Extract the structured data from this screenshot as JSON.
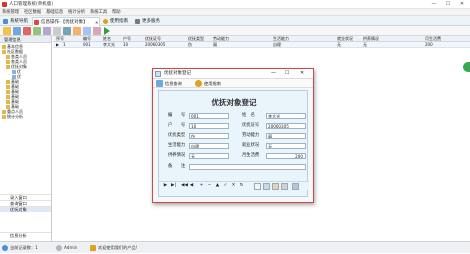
{
  "window": {
    "title": "人口管理系统(单机版)",
    "min": "—",
    "max": "☐",
    "close": "✕"
  },
  "menu": [
    "系统管理",
    "社区数据",
    "基础信息",
    "统计分析",
    "系统工具",
    "帮助"
  ],
  "tabs": [
    {
      "label": "系统导航",
      "active": false,
      "color": "#4a90d9"
    },
    {
      "label": "信息操作-【优抚对象】",
      "active": true,
      "color": "#d94a3a"
    },
    {
      "label": "使用指南",
      "active": false,
      "color": "#e0a020"
    },
    {
      "label": "更多服务",
      "active": false,
      "color": "#7a7a7a"
    }
  ],
  "toolbar_icons": [
    "add-icon",
    "edit-icon",
    "delete-icon",
    "save-icon",
    "cancel-icon",
    "print-icon",
    "refresh-icon",
    "search-icon",
    "filter-icon",
    "export-icon",
    "next-icon"
  ],
  "sidebar": {
    "title": "管理信息",
    "tree": [
      "基本信息",
      "社区数据",
      "各类人员",
      "各类人员",
      "优抚对象",
      "优",
      "优",
      "基础",
      "基础",
      "基础",
      "基础",
      "基础",
      "基础",
      "重点人员",
      "统计分析"
    ],
    "bottom": [
      "录入窗口",
      "查询窗口",
      "优抚对象",
      "信息分析"
    ]
  },
  "grid": {
    "headers": [
      "序号",
      "编号",
      "姓名",
      "户号",
      "优抚证号",
      "优抚类型",
      "劳动能力",
      "生活能力",
      "就业状况",
      "供养情况",
      "月生活费"
    ],
    "row": [
      "1",
      "001",
      "李大光",
      "10",
      "20060305",
      "伤",
      "弱",
      "自理",
      "无",
      "无",
      "200"
    ]
  },
  "dialog": {
    "title": "优抚对象登记",
    "toolbar": [
      "信息查询",
      "使用指南"
    ],
    "form_title": "优抚对象登记",
    "fields": {
      "bianhao": {
        "label": "编　　号",
        "value": "001"
      },
      "xingming": {
        "label": "姓　名",
        "value": "李大光"
      },
      "huhao": {
        "label": "户　　号",
        "value": "10"
      },
      "zhenghao": {
        "label": "优抚证号",
        "value": "20060305"
      },
      "leixing": {
        "label": "优抚类型",
        "value": "伤"
      },
      "laodong": {
        "label": "劳动能力",
        "value": "弱"
      },
      "shenghuo": {
        "label": "生活能力",
        "value": "自理"
      },
      "jiuye": {
        "label": "就业状况",
        "value": "无"
      },
      "gongyang": {
        "label": "供养情况",
        "value": "无"
      },
      "yue": {
        "label": "月生活费",
        "value": "200"
      },
      "beizhu": {
        "label": "备　　注",
        "value": ""
      }
    },
    "nav": [
      "▶",
      "▶|",
      "◀◀",
      "◀",
      "+",
      "−",
      "▲",
      "✓",
      "✕",
      "↻"
    ]
  },
  "status": {
    "left": "当前记录数：1",
    "user": "Admin",
    "message": "欢迎使用我们的产品!"
  }
}
